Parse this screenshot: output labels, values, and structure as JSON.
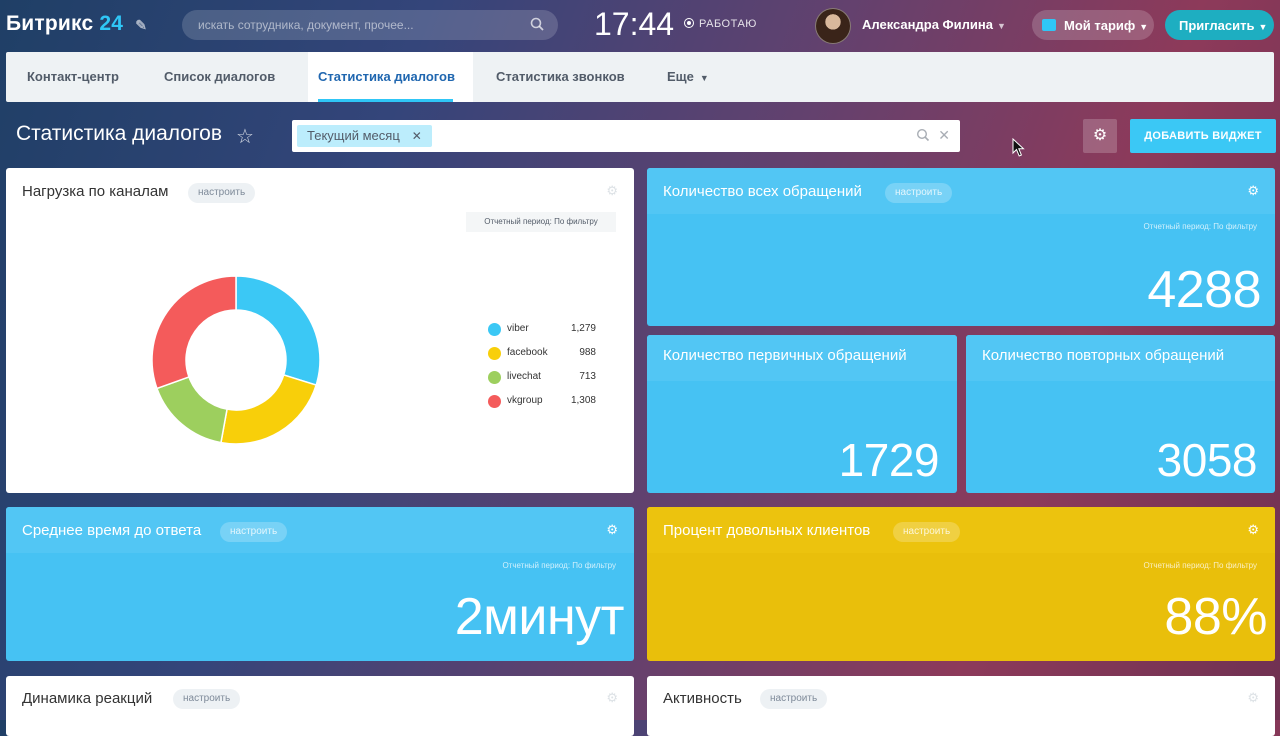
{
  "header": {
    "logo_name": "Битрикс",
    "logo_num": "24",
    "search_placeholder": "искать сотрудника, документ, прочее...",
    "clock": "17:44",
    "work_status": "РАБОТАЮ",
    "user_name": "Александра Филина",
    "tariff_label": "Мой тариф",
    "invite_label": "Пригласить"
  },
  "tabs": [
    {
      "label": "Контакт-центр"
    },
    {
      "label": "Список диалогов"
    },
    {
      "label": "Статистика диалогов",
      "active": true
    },
    {
      "label": "Статистика звонков"
    },
    {
      "label": "Еще"
    }
  ],
  "page": {
    "title": "Статистика диалогов",
    "filter_chip": "Текущий месяц",
    "add_widget_label": "ДОБАВИТЬ ВИДЖЕТ"
  },
  "colors": {
    "accent": "#2fc6f6",
    "widget_blue": "#46c2f3",
    "widget_yellow": "#e9bf0b"
  },
  "widgets": {
    "channels": {
      "title": "Нагрузка по каналам",
      "configure": "настроить",
      "period": "Отчетный период: По фильтру"
    },
    "all_requests": {
      "title": "Количество всех обращений",
      "configure": "настроить",
      "period": "Отчетный период: По фильтру",
      "value": "4288"
    },
    "primary_requests": {
      "title": "Количество первичных обращений",
      "value": "1729"
    },
    "repeat_requests": {
      "title": "Количество повторных обращений",
      "value": "3058"
    },
    "avg_response": {
      "title": "Среднее время до ответа",
      "configure": "настроить",
      "period": "Отчетный период: По фильтру",
      "value": "2минут"
    },
    "satisfied": {
      "title": "Процент довольных клиентов",
      "configure": "настроить",
      "period": "Отчетный период: По фильтру",
      "value": "88%"
    },
    "reaction_dynamics": {
      "title": "Динамика реакций",
      "configure": "настроить"
    },
    "activity": {
      "title": "Активность",
      "configure": "настроить"
    }
  },
  "chart_data": {
    "type": "pie",
    "donut": true,
    "legend_position": "right",
    "slices": [
      {
        "name": "viber",
        "value": 1279,
        "label": "1,279",
        "color": "#3bc8f5"
      },
      {
        "name": "facebook",
        "value": 988,
        "label": "988",
        "color": "#f8cf0a"
      },
      {
        "name": "livechat",
        "value": 713,
        "label": "713",
        "color": "#9dcf5e"
      },
      {
        "name": "vkgroup",
        "value": 1308,
        "label": "1,308",
        "color": "#f45b5b"
      }
    ]
  }
}
